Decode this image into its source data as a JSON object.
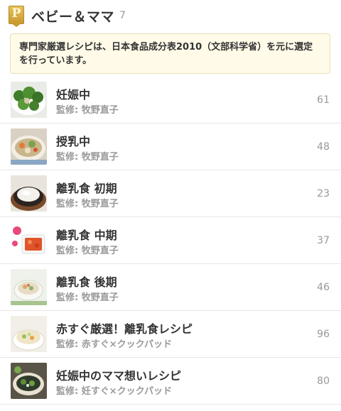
{
  "header": {
    "badge": "P",
    "title": "ベビー＆ママ",
    "count": "7"
  },
  "notice": {
    "text": "専門家厳選レシピは、日本食品成分表2010（文部科学省）を元に選定を行っています。"
  },
  "items": [
    {
      "title": "妊娠中",
      "supervisor": "監修: 牧野直子",
      "count": "61",
      "thumb_icon": "broccoli-dish-photo"
    },
    {
      "title": "授乳中",
      "supervisor": "監修: 牧野直子",
      "count": "48",
      "thumb_icon": "vegetable-soup-photo"
    },
    {
      "title": "離乳食 初期",
      "supervisor": "監修: 牧野直子",
      "count": "23",
      "thumb_icon": "porridge-bowl-photo"
    },
    {
      "title": "離乳食 中期",
      "supervisor": "監修: 牧野直子",
      "count": "37",
      "thumb_icon": "tomato-dish-photo"
    },
    {
      "title": "離乳食 後期",
      "supervisor": "監修: 牧野直子",
      "count": "46",
      "thumb_icon": "rice-bowl-photo"
    },
    {
      "title": "赤すぐ厳選！離乳食レシピ",
      "supervisor": "監修: 赤すぐ×クックパッド",
      "count": "96",
      "thumb_icon": "soup-cup-photo"
    },
    {
      "title": "妊娠中のママ想いレシピ",
      "supervisor": "監修: 妊すぐ×クックパッド",
      "count": "80",
      "thumb_icon": "seaweed-salad-photo"
    }
  ],
  "colors": {
    "notice_bg": "#fffbe8",
    "badge_gold": "#c99a2e",
    "muted_text": "#999999"
  }
}
